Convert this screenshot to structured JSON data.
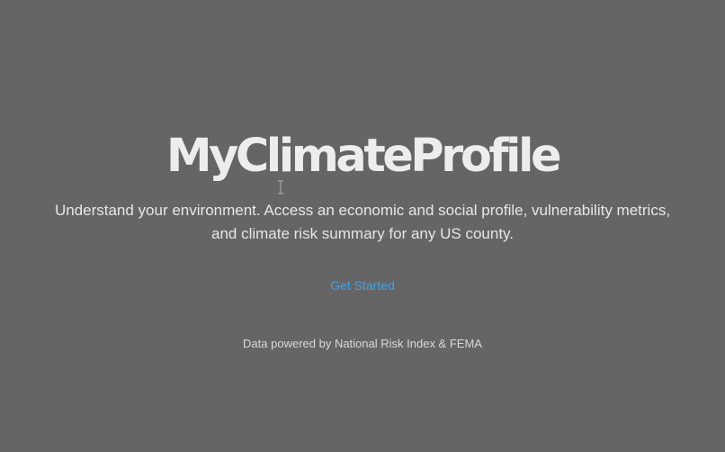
{
  "hero": {
    "title": "MyClimateProfile",
    "subtitle_line1": "Understand your environment. Access an economic and social profile, vulnerability metrics,",
    "subtitle_line2": "and climate risk summary for any US county.",
    "cta_label": "Get Started",
    "footer_note": "Data powered by National Risk Index & FEMA"
  },
  "colors": {
    "background": "#656566",
    "title": "#ededed",
    "link": "#3ea2ea"
  },
  "icons": {
    "cursor": "text-cursor-icon"
  }
}
